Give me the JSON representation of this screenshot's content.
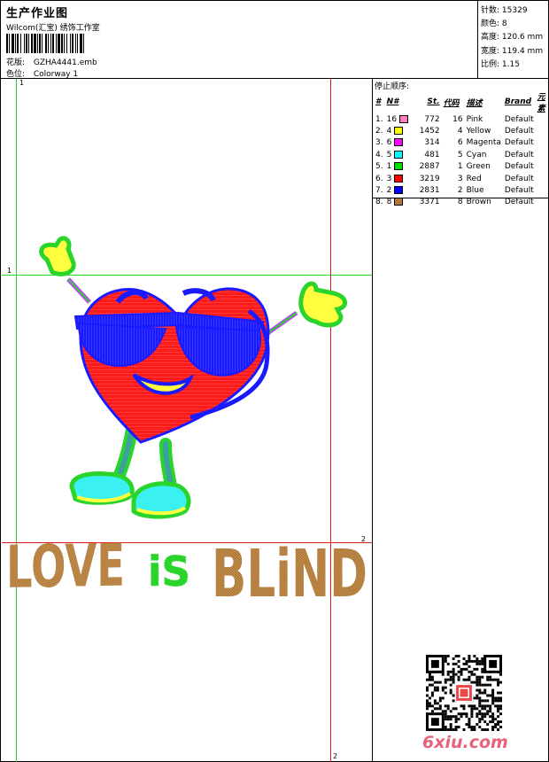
{
  "header": {
    "title": "生产作业图",
    "company": "Wilcom(汇宝) 绣饰工作室",
    "design_label": "花版:",
    "design_value": "GZHA4441.emb",
    "colorway_label": "色位:",
    "colorway_value": "Colorway 1"
  },
  "stats": {
    "stitches_label": "针数:",
    "stitches_value": "15329",
    "colors_label": "颜色:",
    "colors_value": "8",
    "height_label": "高度:",
    "height_value": "120.6 mm",
    "width_label": "宽度:",
    "width_value": "119.4 mm",
    "ratio_label": "比例:",
    "ratio_value": "1.15"
  },
  "stop_sequence": {
    "title": "停止顺序:",
    "columns": [
      "#",
      "N#",
      "St.",
      "代码",
      "描述",
      "Brand",
      "元素"
    ],
    "rows": [
      {
        "idx": "1.",
        "n": "16",
        "color": "#ff80c0",
        "st": "772",
        "code": "16",
        "desc": "Pink",
        "brand": "Default"
      },
      {
        "idx": "2.",
        "n": "4",
        "color": "#ffff00",
        "st": "1452",
        "code": "4",
        "desc": "Yellow",
        "brand": "Default"
      },
      {
        "idx": "3.",
        "n": "6",
        "color": "#ff00ff",
        "st": "314",
        "code": "6",
        "desc": "Magenta",
        "brand": "Default"
      },
      {
        "idx": "4.",
        "n": "5",
        "color": "#00ffff",
        "st": "481",
        "code": "5",
        "desc": "Cyan",
        "brand": "Default"
      },
      {
        "idx": "5.",
        "n": "1",
        "color": "#00e000",
        "st": "2887",
        "code": "1",
        "desc": "Green",
        "brand": "Default"
      },
      {
        "idx": "6.",
        "n": "3",
        "color": "#ff0000",
        "st": "3219",
        "code": "3",
        "desc": "Red",
        "brand": "Default"
      },
      {
        "idx": "7.",
        "n": "2",
        "color": "#0000ff",
        "st": "2831",
        "code": "2",
        "desc": "Blue",
        "brand": "Default"
      },
      {
        "idx": "8.",
        "n": "8",
        "color": "#b07838",
        "st": "3371",
        "code": "8",
        "desc": "Brown",
        "brand": "Default"
      }
    ]
  },
  "guides": {
    "green_v_label": "1",
    "green_h_label": "1",
    "red_h_label": "2",
    "red_v_label": "2"
  },
  "artwork": {
    "word_love": "LOVE",
    "word_is": "iS",
    "word_blind": "BLiND"
  },
  "watermark": {
    "site": "6xiu.com"
  }
}
